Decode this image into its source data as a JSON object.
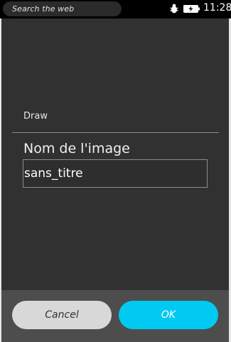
{
  "status_bar": {
    "search_text": "Search the web",
    "time": "11:28",
    "icons": [
      "bug-icon",
      "battery-charging-icon"
    ]
  },
  "dialog": {
    "title": "Draw",
    "field_label": "Nom de l'image",
    "field_value": "sans_titre"
  },
  "footer": {
    "cancel_label": "Cancel",
    "ok_label": "OK"
  },
  "colors": {
    "accent": "#00caf2",
    "dialog_bg": "#313131",
    "footer_bg": "#4d4d4d",
    "cancel_bg": "#d8d8d8"
  }
}
